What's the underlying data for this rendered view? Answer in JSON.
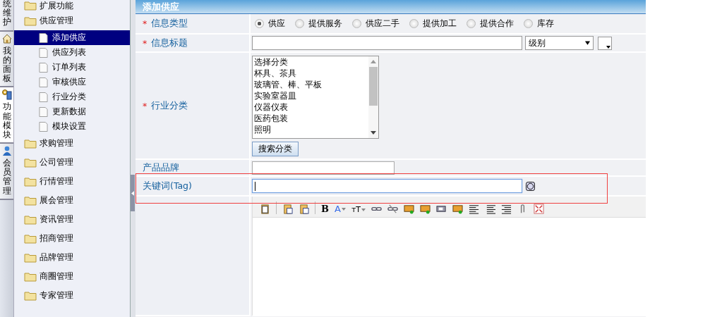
{
  "vertical_tabs": [
    {
      "label": "统维护",
      "selected": false
    },
    {
      "label": "我的面板",
      "selected": false
    },
    {
      "label": "功能模块",
      "selected": true
    },
    {
      "label": "会员管理",
      "selected": false
    }
  ],
  "sidebar": {
    "items": [
      {
        "label": "扩展功能"
      },
      {
        "label": "供应管理",
        "children": [
          {
            "label": "添加供应",
            "selected": true
          },
          {
            "label": "供应列表",
            "selected": false
          },
          {
            "label": "订单列表",
            "selected": false
          },
          {
            "label": "审核供应",
            "selected": false
          },
          {
            "label": "行业分类",
            "selected": false
          },
          {
            "label": "更新数据",
            "selected": false
          },
          {
            "label": "模块设置",
            "selected": false
          }
        ]
      },
      {
        "label": "求购管理"
      },
      {
        "label": "公司管理"
      },
      {
        "label": "行情管理"
      },
      {
        "label": "展会管理"
      },
      {
        "label": "资讯管理"
      },
      {
        "label": "招商管理"
      },
      {
        "label": "品牌管理"
      },
      {
        "label": "商圈管理"
      },
      {
        "label": "专家管理"
      }
    ]
  },
  "panel": {
    "title": "添加供应"
  },
  "form": {
    "info_type": {
      "label": "信息类型",
      "marker": "*",
      "options": [
        {
          "label": "供应",
          "selected": true
        },
        {
          "label": "提供服务",
          "selected": false
        },
        {
          "label": "供应二手",
          "selected": false
        },
        {
          "label": "提供加工",
          "selected": false
        },
        {
          "label": "提供合作",
          "selected": false
        },
        {
          "label": "库存",
          "selected": false
        }
      ]
    },
    "info_title": {
      "label": "信息标题",
      "marker": "*",
      "level_select": "级别"
    },
    "category": {
      "label": "行业分类",
      "marker": "*",
      "options": [
        "选择分类",
        "杯具、茶具",
        "玻璃管、棒、平板",
        "实验室器皿",
        "仪器仪表",
        "医药包装",
        "照明"
      ],
      "search_button": "搜索分类"
    },
    "brand": {
      "label": "产品品牌"
    },
    "keywords": {
      "label": "关键词(Tag)",
      "focused": true
    }
  },
  "editor": {
    "toolbar": {
      "bold": "B",
      "font_color": "A",
      "font_size": "тT"
    }
  }
}
